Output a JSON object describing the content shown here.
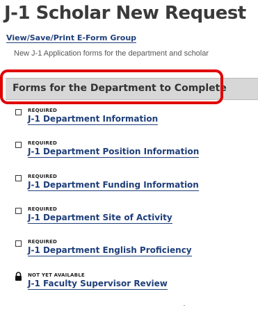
{
  "page": {
    "title": "J-1 Scholar New Request",
    "group_link": "View/Save/Print E-Form Group",
    "description": "New J-1 Application forms for the department and scholar"
  },
  "section": {
    "title": "Forms for the Department to Complete",
    "highlight_color": "#e00000"
  },
  "forms": [
    {
      "status": "REQUIRED",
      "label": "J-1 Department Information",
      "icon": "checkbox-icon"
    },
    {
      "status": "REQUIRED",
      "label": "J-1 Department Position Information",
      "icon": "checkbox-icon"
    },
    {
      "status": "REQUIRED",
      "label": "J-1 Department Funding Information",
      "icon": "checkbox-icon"
    },
    {
      "status": "REQUIRED",
      "label": "J-1 Department Site of Activity",
      "icon": "checkbox-icon"
    },
    {
      "status": "REQUIRED",
      "label": "J-1 Department English Proficiency",
      "icon": "checkbox-icon"
    },
    {
      "status": "NOT YET AVAILABLE",
      "label": "J-1 Faculty Supervisor Review",
      "icon": "lock-icon"
    }
  ],
  "colors": {
    "link": "#1f3f7a",
    "section_bg": "#d7d7d7",
    "title": "#3a3a3a"
  }
}
